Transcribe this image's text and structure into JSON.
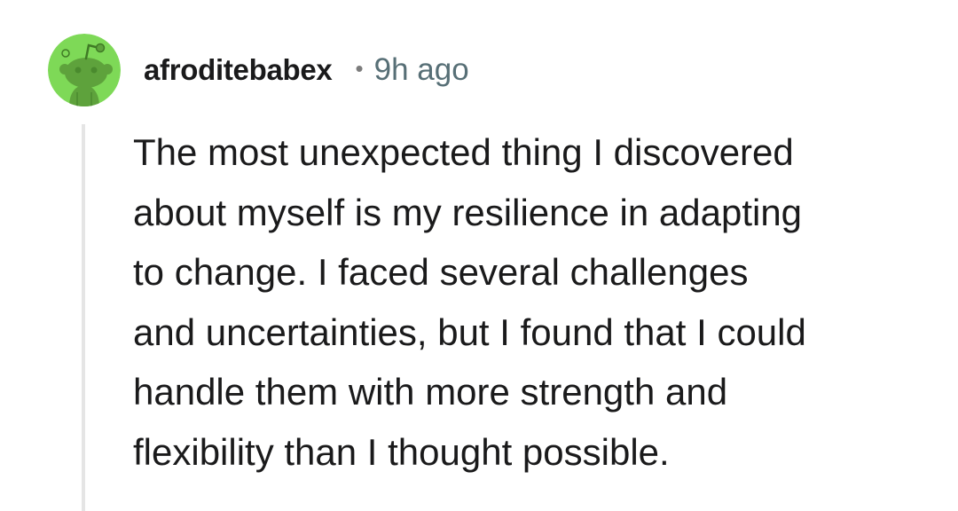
{
  "comment": {
    "author": "afroditebabex",
    "separator": "•",
    "time_ago": "9h ago",
    "avatar_icon": "reddit-snoo-avatar-icon",
    "avatar_color": "#7ed957",
    "body_lines": [
      "The most unexpected thing I discovered",
      "about myself is my resilience in adapting",
      "to change. I faced several challenges",
      "and uncertainties, but I found that I could",
      "handle them with more strength and",
      "flexibility than I thought possible."
    ]
  }
}
